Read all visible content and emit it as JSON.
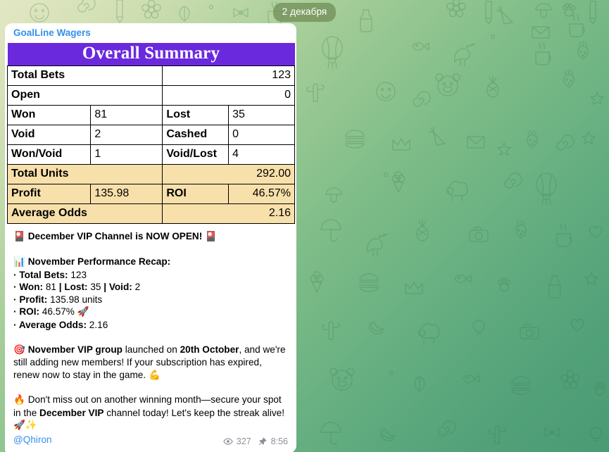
{
  "chat": {
    "date_divider": "2 декабря",
    "background_accent": "#7fbd88"
  },
  "message": {
    "channel_name": "GoalLine Wagers",
    "handle": "@Qhiron",
    "views": "327",
    "time": "8:56",
    "view_icon": "eye-icon",
    "pin_icon": "pin-icon"
  },
  "summary_table": {
    "title": "Overall Summary",
    "title_bg": "#6b29de",
    "highlight_bg": "#f8e0ab",
    "rows": [
      {
        "type": "wide",
        "label": "Total Bets",
        "value": "123"
      },
      {
        "type": "wide",
        "label": "Open",
        "value": "0"
      },
      {
        "type": "quad",
        "label": "Won",
        "value": "81",
        "label2": "Lost",
        "value2": "35"
      },
      {
        "type": "quad",
        "label": "Void",
        "value": "2",
        "label2": "Cashed",
        "value2": "0"
      },
      {
        "type": "quad",
        "label": "Won/Void",
        "value": "1",
        "label2": "Void/Lost",
        "value2": "4"
      },
      {
        "type": "wide",
        "label": "Total Units",
        "value": "292.00",
        "tan": true
      },
      {
        "type": "quad",
        "label": "Profit",
        "value": "135.98",
        "label2": "ROI",
        "value2": "46.57%",
        "tan": true
      },
      {
        "type": "wide",
        "label": "Average Odds",
        "value": "2.16",
        "tan": true
      }
    ]
  },
  "body": {
    "headline_emoji_left": "🎴",
    "headline": "December VIP Channel is NOW OPEN!",
    "headline_emoji_right": "🎴",
    "recap_emoji": "📊",
    "recap_title": "November Performance Recap:",
    "recap_lines": [
      {
        "bullet": "·",
        "label": "Total Bets:",
        "value": " 123"
      },
      {
        "bullet": "·",
        "label": "Won:",
        "value": " 81 ",
        "label_b": "| Lost:",
        "value_b": " 35 ",
        "label_c": "| Void:",
        "value_c": " 2"
      },
      {
        "bullet": "·",
        "label": "Profit:",
        "value": " 135.98 units"
      },
      {
        "bullet": "·",
        "label": "ROI:",
        "value": " 46.57% ",
        "emoji": "🚀"
      },
      {
        "bullet": "·",
        "label": "Average Odds:",
        "value": " 2.16"
      }
    ],
    "para2_emoji": "🎯",
    "para2_bold_1": "November VIP group",
    "para2_mid": " launched on ",
    "para2_bold_2": "20th October",
    "para2_rest": ", and we're still adding new members! If your subscription has expired, renew now to stay in the game. ",
    "para2_emoji_end": "💪",
    "para3_emoji": "🔥",
    "para3_start": " Don't miss out on another winning month—secure your spot in the ",
    "para3_bold": "December VIP",
    "para3_rest": " channel today! Let's keep the streak alive! ",
    "para3_emoji_end": "🚀✨"
  }
}
